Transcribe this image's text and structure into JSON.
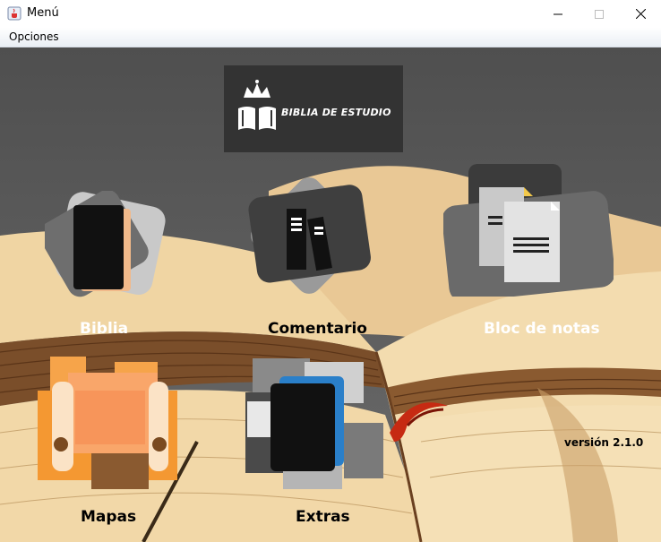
{
  "window": {
    "title": "Menú",
    "icon": "java-cup-icon"
  },
  "menubar": {
    "items": [
      "Opciones"
    ]
  },
  "logo": {
    "text": "BIBLIA DE ESTUDIO",
    "icon": "crown-book-icon"
  },
  "tiles": [
    {
      "label": "Biblia",
      "icon": "book-icon"
    },
    {
      "label": "Comentario",
      "icon": "books-icon"
    },
    {
      "label": "Bloc de notas",
      "icon": "notes-icon"
    },
    {
      "label": "Mapas",
      "icon": "scroll-map-icon"
    },
    {
      "label": "Extras",
      "icon": "tablet-stack-icon"
    }
  ],
  "version": "versión 2.1.0",
  "colors": {
    "logo_bg": "#333333",
    "tile_gray": "#6e6e6e",
    "paper": "#f1d6a8"
  }
}
